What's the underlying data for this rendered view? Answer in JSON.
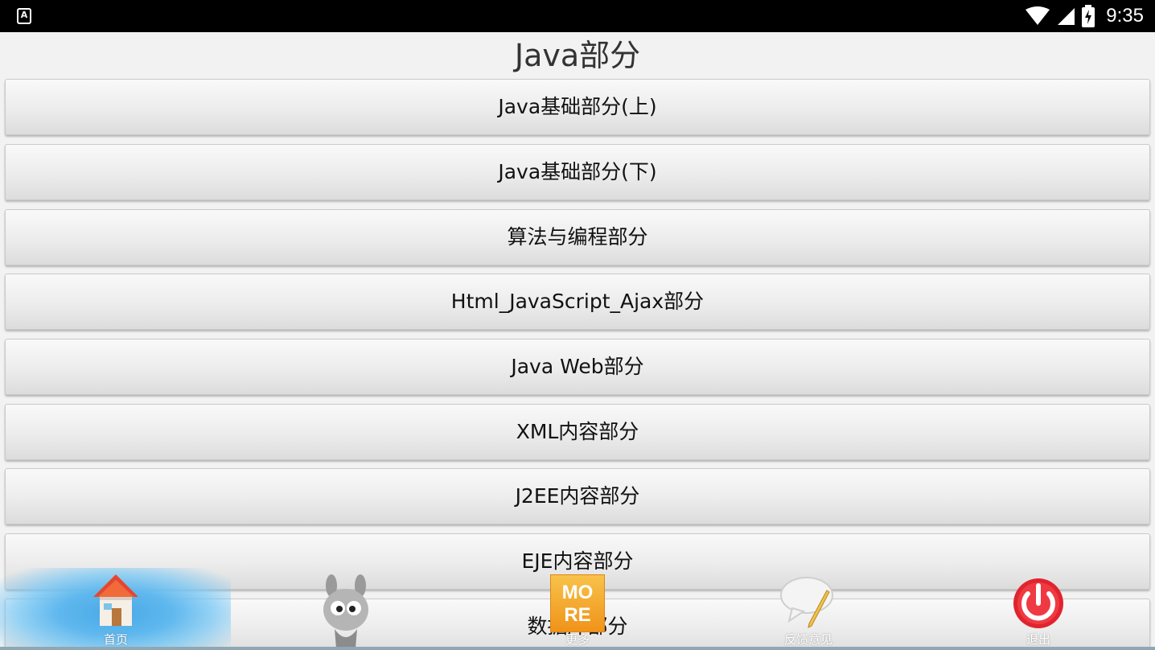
{
  "status_bar": {
    "app_icon_letter": "A",
    "time": "9:35"
  },
  "page": {
    "title": "Java部分"
  },
  "menu_items": [
    "Java基础部分(上)",
    "Java基础部分(下)",
    "算法与编程部分",
    "Html_JavaScript_Ajax部分",
    "Java Web部分",
    "XML内容部分",
    "J2EE内容部分",
    "EJE内容部分",
    "数据库部分"
  ],
  "tab_bar": {
    "tabs": [
      {
        "label": "首页",
        "icon": "home-icon",
        "selected": true
      },
      {
        "label": "",
        "icon": "mascot-icon"
      },
      {
        "label": "更多",
        "icon": "more-icon",
        "badge_line1": "MO",
        "badge_line2": "RE"
      },
      {
        "label": "反馈意见",
        "icon": "feedback-icon"
      },
      {
        "label": "退出",
        "icon": "power-icon"
      }
    ],
    "selected_color": "#4aa8e6"
  }
}
